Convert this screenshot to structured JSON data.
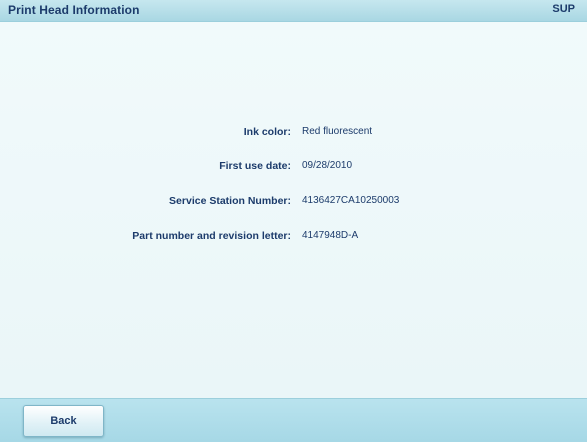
{
  "header": {
    "title": "Print Head Information",
    "mode": "SUP"
  },
  "info": [
    {
      "label": "Ink color:",
      "value": "Red fluorescent"
    },
    {
      "label": "First use date:",
      "value": "09/28/2010"
    },
    {
      "label": "Service Station Number:",
      "value": "4136427CA10250003"
    },
    {
      "label": "Part number and revision letter:",
      "value": "4147948D-A"
    }
  ],
  "footer": {
    "back_label": "Back"
  }
}
